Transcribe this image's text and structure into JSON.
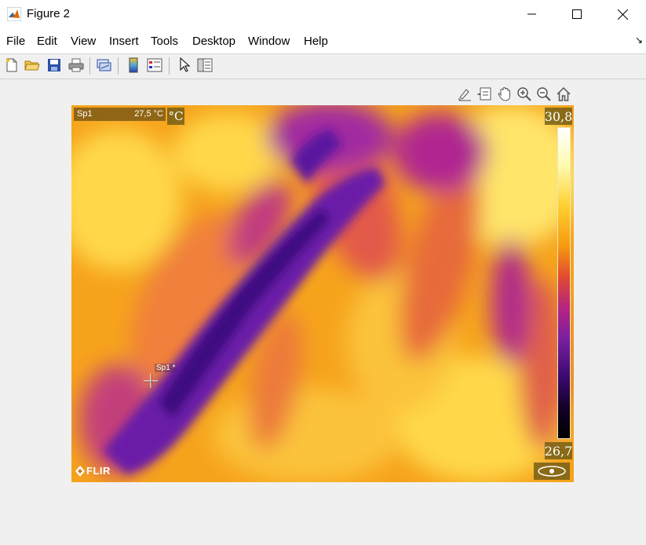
{
  "window": {
    "title": "Figure 2"
  },
  "menu": [
    "File",
    "Edit",
    "View",
    "Insert",
    "Tools",
    "Desktop",
    "Window",
    "Help"
  ],
  "toolbar_icons": [
    "new-figure-icon",
    "open-file-icon",
    "save-icon",
    "print-icon",
    "link-plot-icon",
    "colorbar-icon",
    "legend-icon",
    "edit-plot-icon",
    "property-inspector-icon"
  ],
  "axes_toolbar_icons": [
    "brush-icon",
    "data-tips-icon",
    "pan-icon",
    "zoom-in-icon",
    "zoom-out-icon",
    "home-icon"
  ],
  "thermal": {
    "spot_label": "Sp1",
    "spot_value": "27,5 °C",
    "unit": "°C",
    "scale_max": "30,8",
    "scale_min": "26,7",
    "marker_tag": "Sp1 *",
    "brand": "FLIR"
  },
  "colors": {
    "accent_window": "#ffffff",
    "background": "#f0f0f0"
  }
}
